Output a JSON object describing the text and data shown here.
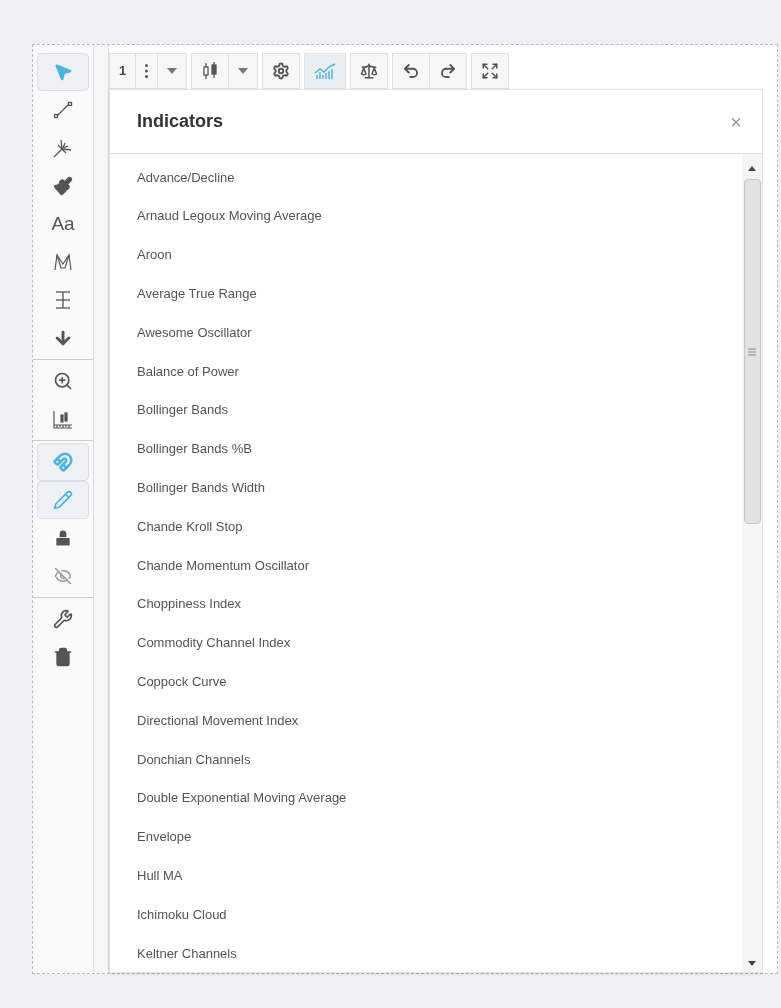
{
  "sidebar": {
    "groups": [
      [
        {
          "kind": "icon",
          "selected": true
        },
        {
          "kind": "icon",
          "selected": false
        },
        {
          "kind": "icon",
          "selected": false
        },
        {
          "kind": "icon",
          "selected": false
        },
        {
          "kind": "text",
          "label": "Aa",
          "selected": false
        },
        {
          "kind": "icon",
          "selected": false
        },
        {
          "kind": "icon",
          "selected": false
        },
        {
          "kind": "icon",
          "selected": false
        }
      ],
      [
        {
          "kind": "icon",
          "selected": false
        },
        {
          "kind": "icon",
          "selected": false
        }
      ],
      [
        {
          "kind": "icon",
          "selected": true
        },
        {
          "kind": "icon",
          "selected": true
        },
        {
          "kind": "icon",
          "selected": false
        },
        {
          "kind": "icon",
          "selected": false
        }
      ],
      [
        {
          "kind": "icon",
          "selected": false
        },
        {
          "kind": "icon",
          "selected": false
        }
      ]
    ]
  },
  "toolbar": {
    "groups": [
      [
        {
          "kind": "text",
          "label": "1",
          "selected": false
        },
        {
          "kind": "icon",
          "selected": false
        },
        {
          "kind": "icon",
          "selected": false
        }
      ],
      [
        {
          "kind": "icon",
          "selected": false
        },
        {
          "kind": "icon",
          "selected": false
        }
      ],
      [
        {
          "kind": "icon",
          "selected": false
        }
      ],
      [
        {
          "kind": "icon",
          "selected": true
        }
      ],
      [
        {
          "kind": "icon",
          "selected": false
        }
      ],
      [
        {
          "kind": "icon",
          "selected": false
        },
        {
          "kind": "icon",
          "selected": false
        }
      ],
      [
        {
          "kind": "icon",
          "selected": false
        }
      ]
    ]
  },
  "dialog": {
    "title": "Indicators",
    "close": "×",
    "items": [
      "Advance/Decline",
      "Arnaud Legoux Moving Average",
      "Aroon",
      "Average True Range",
      "Awesome Oscillator",
      "Balance of Power",
      "Bollinger Bands",
      "Bollinger Bands %B",
      "Bollinger Bands Width",
      "Chande Kroll Stop",
      "Chande Momentum Oscillator",
      "Choppiness Index",
      "Commodity Channel Index",
      "Coppock Curve",
      "Directional Movement Index",
      "Donchian Channels",
      "Double Exponential Moving Average",
      "Envelope",
      "Hull MA",
      "Ichimoku Cloud",
      "Keltner Channels"
    ]
  }
}
